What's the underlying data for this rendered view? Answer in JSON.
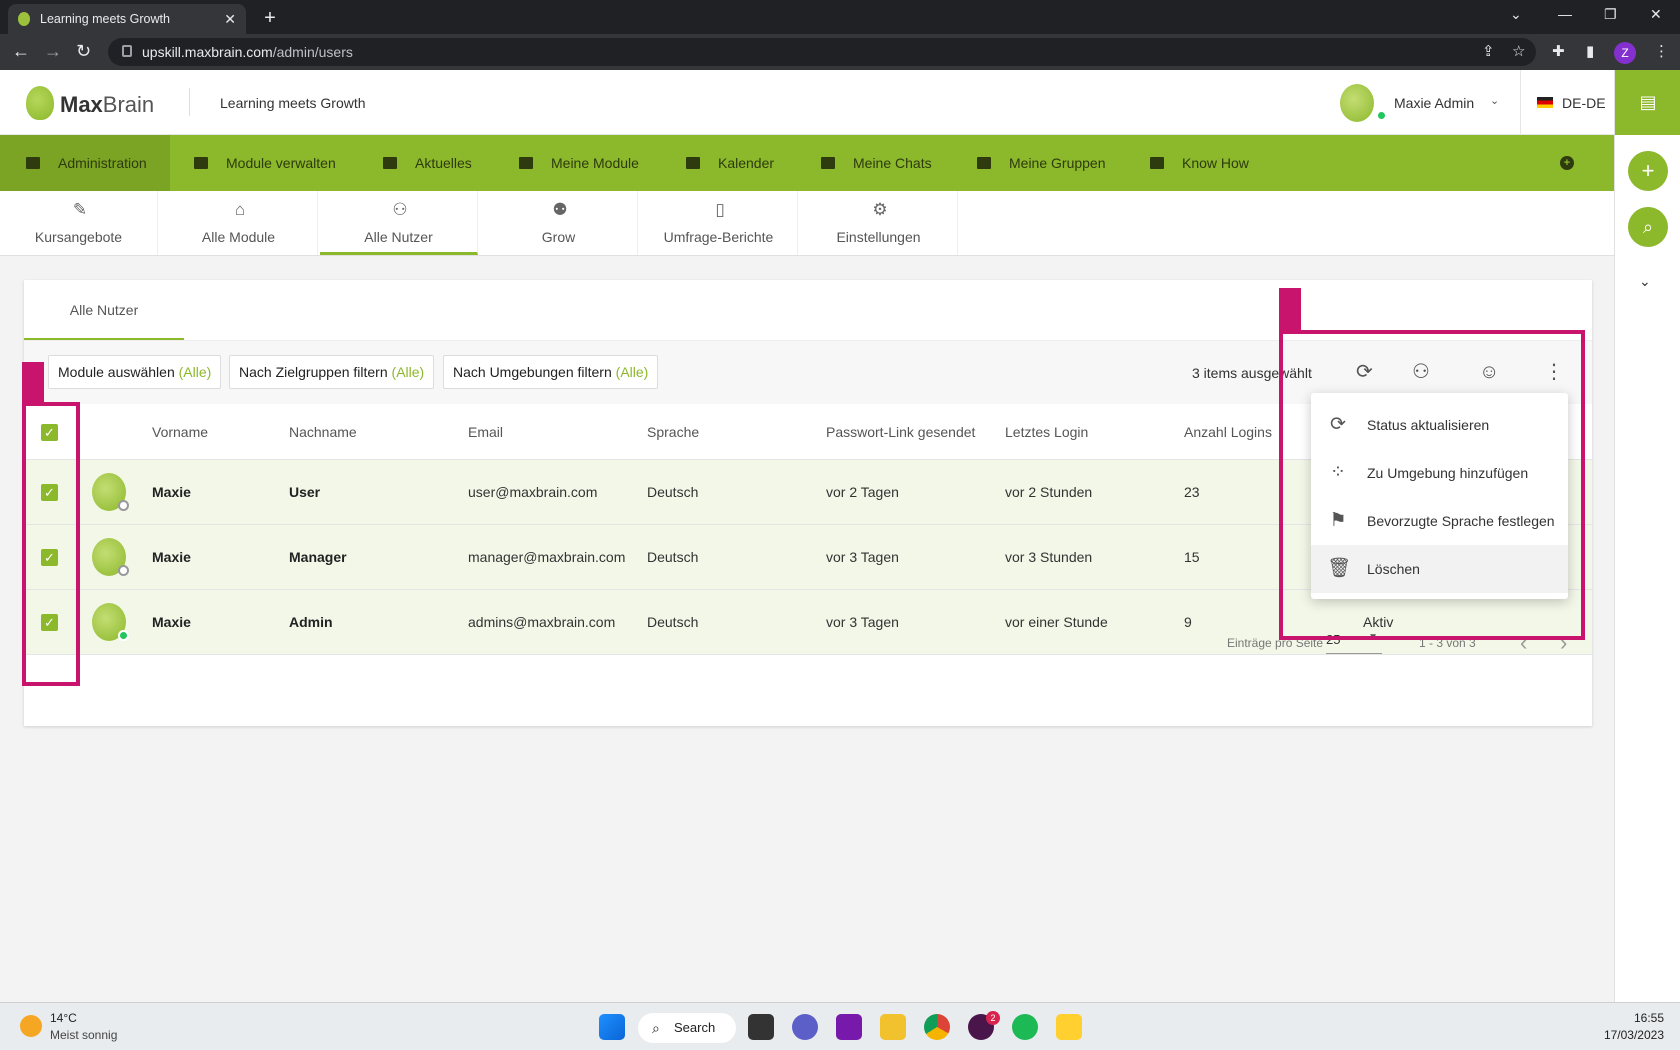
{
  "browser": {
    "tab_title": "Learning meets Growth",
    "url_host": "upskill.maxbrain.com",
    "url_path": "/admin/users",
    "profile_initial": "Z"
  },
  "header": {
    "logo_bold": "Max",
    "logo_light": "Brain",
    "slogan": "Learning meets Growth",
    "user_name": "Maxie Admin",
    "language": "DE-DE"
  },
  "main_nav": [
    {
      "label": "Administration",
      "icon": "admin-icon"
    },
    {
      "label": "Module verwalten",
      "icon": "modules-manage-icon"
    },
    {
      "label": "Aktuelles",
      "icon": "news-icon"
    },
    {
      "label": "Meine Module",
      "icon": "graduation-cap-icon"
    },
    {
      "label": "Kalender",
      "icon": "calendar-icon"
    },
    {
      "label": "Meine Chats",
      "icon": "chat-icon"
    },
    {
      "label": "Meine Gruppen",
      "icon": "groups-icon"
    },
    {
      "label": "Know How",
      "icon": "book-icon"
    }
  ],
  "sub_tabs": [
    {
      "label": "Kursangebote"
    },
    {
      "label": "Alle Module"
    },
    {
      "label": "Alle Nutzer"
    },
    {
      "label": "Grow"
    },
    {
      "label": "Umfrage-Berichte"
    },
    {
      "label": "Einstellungen"
    }
  ],
  "card": {
    "tab_label": "Alle Nutzer",
    "filters": [
      {
        "label": "Module auswählen",
        "value": "(Alle)"
      },
      {
        "label": "Nach Zielgruppen filtern",
        "value": "(Alle)"
      },
      {
        "label": "Nach Umgebungen filtern",
        "value": "(Alle)"
      }
    ],
    "selected_text": "3 items ausgewählt"
  },
  "table": {
    "columns": [
      "Vorname",
      "Nachname",
      "Email",
      "Sprache",
      "Passwort-Link gesendet",
      "Letztes Login",
      "Anzahl Logins"
    ],
    "rows": [
      {
        "first": "Maxie",
        "last": "User",
        "email": "user@maxbrain.com",
        "lang": "Deutsch",
        "pw": "vor 2 Tagen",
        "login": "vor 2 Stunden",
        "count": "23",
        "status": ""
      },
      {
        "first": "Maxie",
        "last": "Manager",
        "email": "manager@maxbrain.com",
        "lang": "Deutsch",
        "pw": "vor 3 Tagen",
        "login": "vor 3 Stunden",
        "count": "15",
        "status": ""
      },
      {
        "first": "Maxie",
        "last": "Admin",
        "email": "admins@maxbrain.com",
        "lang": "Deutsch",
        "pw": "vor 3 Tagen",
        "login": "vor einer Stunde",
        "count": "9",
        "status": "Aktiv"
      }
    ]
  },
  "pagination": {
    "per_page_label": "Einträge pro Seite",
    "per_page_value": "25",
    "range": "1 - 3 von 3"
  },
  "menu": [
    {
      "label": "Status aktualisieren",
      "icon": "refresh-icon"
    },
    {
      "label": "Zu Umgebung hinzufügen",
      "icon": "environment-icon"
    },
    {
      "label": "Bevorzugte Sprache festlegen",
      "icon": "flag-icon"
    },
    {
      "label": "Löschen",
      "icon": "trash-icon"
    }
  ],
  "taskbar": {
    "temp": "14°C",
    "weather": "Meist sonnig",
    "search_label": "Search",
    "time": "16:55",
    "date": "17/03/2023",
    "slack_badge": "2"
  },
  "colors": {
    "brand_green": "#8cb82b",
    "highlight": "#c8146c"
  }
}
